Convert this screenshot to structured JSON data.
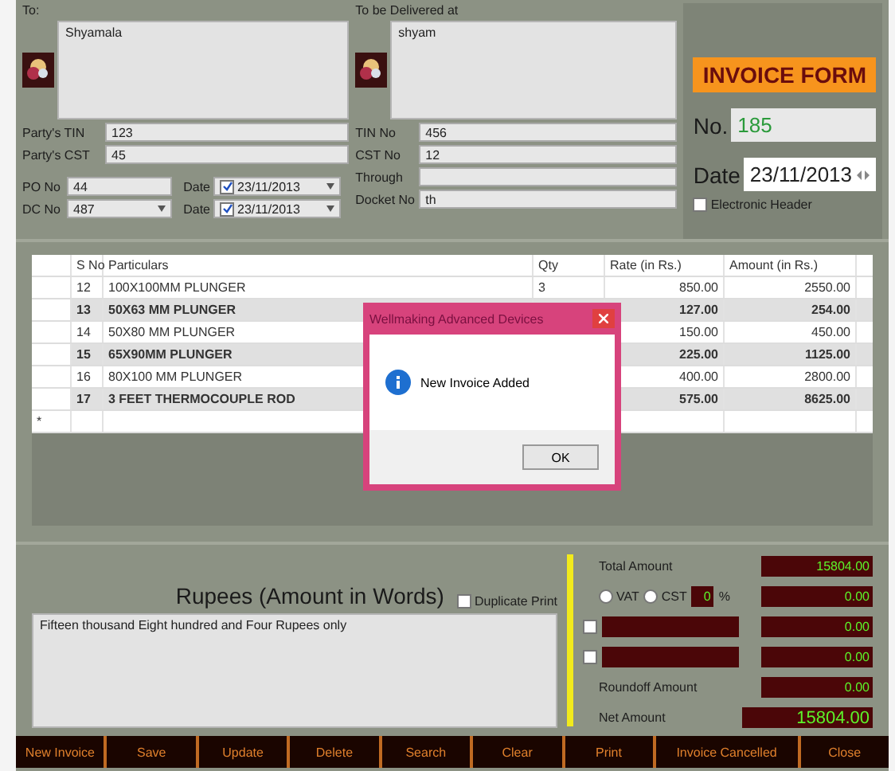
{
  "to_panel": {
    "label": "To:",
    "name": "Shyamala",
    "fields": [
      {
        "label": "Party's TIN",
        "value": "123"
      },
      {
        "label": "Party's CST",
        "value": "45"
      }
    ],
    "po": {
      "label": "PO No",
      "value": "44",
      "date_label": "Date",
      "date": "23/11/2013",
      "date_checked": true
    },
    "dc": {
      "label": "DC No",
      "value": "487",
      "date_label": "Date",
      "date": "23/11/2013",
      "date_checked": true
    }
  },
  "delivery_panel": {
    "label": "To be Delivered at",
    "address": "shyam",
    "fields": [
      {
        "label": "TIN No",
        "value": "456"
      },
      {
        "label": "CST No",
        "value": "12"
      },
      {
        "label": "Through"
      },
      {
        "label": "Docket No",
        "value": "th"
      }
    ]
  },
  "invoice_panel": {
    "title": "INVOICE FORM",
    "number_label": "No.",
    "number": "185",
    "date_label": "Date",
    "date": "23/11/2013",
    "header_checkbox": {
      "label": "Electronic Header",
      "checked": false
    }
  },
  "grid": {
    "columns": [
      "S No",
      "Particulars",
      "Qty",
      "Rate (in Rs.)",
      "Amount (in Rs.)"
    ],
    "rows": [
      {
        "sno": "12",
        "particulars": "100X100MM PLUNGER",
        "qty": "3",
        "rate": "850.00",
        "amount": "2550.00",
        "highlighted": false
      },
      {
        "sno": "13",
        "particulars": "50X63 MM PLUNGER",
        "rate": "127.00",
        "amount": "254.00",
        "highlighted": true
      },
      {
        "sno": "14",
        "particulars": "50X80 MM PLUNGER",
        "rate": "150.00",
        "amount": "450.00",
        "highlighted": false
      },
      {
        "sno": "15",
        "particulars": "65X90MM PLUNGER",
        "rate": "225.00",
        "amount": "1125.00",
        "highlighted": true
      },
      {
        "sno": "16",
        "particulars": "80X100 MM PLUNGER",
        "rate": "400.00",
        "amount": "2800.00",
        "highlighted": false
      },
      {
        "sno": "17",
        "particulars": "3 FEET THERMOCOUPLE ROD",
        "rate": "575.00",
        "amount": "8625.00",
        "highlighted": true
      }
    ],
    "new_row_marker": "*"
  },
  "dialog": {
    "title": "Wellmaking Advanced Devices",
    "message": "New Invoice Added",
    "button": "OK"
  },
  "words": {
    "heading": "Rupees (Amount in Words)",
    "duplicate": {
      "label": "Duplicate Print",
      "checked": false
    },
    "text": "Fifteen thousand Eight hundred  and Four Rupees only"
  },
  "totals": {
    "total": {
      "label": "Total Amount",
      "value": "15804.00"
    },
    "tax": {
      "options": [
        {
          "label": "VAT",
          "selected": false
        },
        {
          "label": "CST",
          "selected": false
        }
      ],
      "percent": "0",
      "percent_sign": "%",
      "value": "0.00"
    },
    "extras": [
      {
        "checked": false,
        "value": "0.00"
      },
      {
        "checked": false,
        "value": "0.00"
      }
    ],
    "roundoff": {
      "label": "Roundoff Amount",
      "value": "0.00"
    },
    "net": {
      "label": "Net Amount",
      "value": "15804.00"
    }
  },
  "buttons": [
    "New Invoice",
    "Save",
    "Update",
    "Delete",
    "Search",
    "Clear",
    "Print",
    "Invoice Cancelled",
    "Close"
  ]
}
